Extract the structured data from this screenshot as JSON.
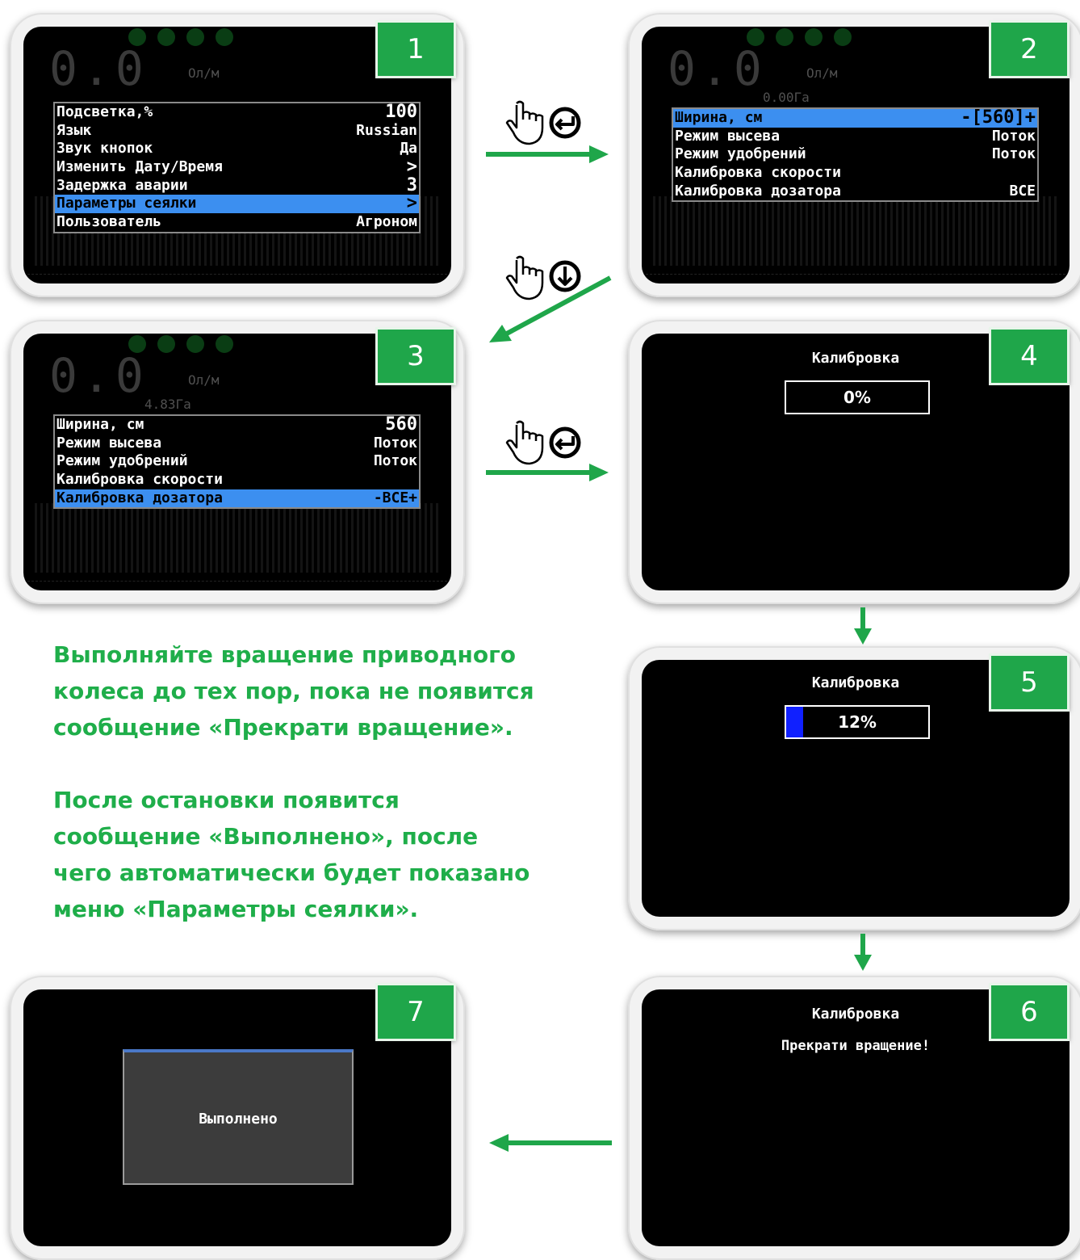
{
  "colors": {
    "accent_green": "#1fa64a",
    "selection_blue": "#3c8ff0",
    "progress_blue": "#1020ff"
  },
  "dashboard": {
    "value": "0.0",
    "rate_units": "Ол/м"
  },
  "steps": {
    "s1": {
      "number": "1",
      "menu": [
        {
          "label": "Подсветка,%",
          "value": "100"
        },
        {
          "label": "Язык",
          "value": "Russian"
        },
        {
          "label": "Звук кнопок",
          "value": "Да"
        },
        {
          "label": "Изменить Дату/Время",
          "value": ">"
        },
        {
          "label": "Задержка аварии",
          "value": "3"
        },
        {
          "label": "Параметры сеялки",
          "value": ">"
        },
        {
          "label": "Пользователь",
          "value": "Агроном"
        }
      ]
    },
    "s2": {
      "number": "2",
      "area": "0.00Га",
      "menu": [
        {
          "label": "Ширина, см",
          "value": "-[560]+"
        },
        {
          "label": "Режим высева",
          "value": "Поток"
        },
        {
          "label": "Режим удобрений",
          "value": "Поток"
        },
        {
          "label": "Калибровка скорости",
          "value": ""
        },
        {
          "label": "Калибровка дозатора",
          "value": "ВСЕ"
        }
      ]
    },
    "s3": {
      "number": "3",
      "area": "4.83Га",
      "menu": [
        {
          "label": "Ширина, см",
          "value": "560"
        },
        {
          "label": "Режим высева",
          "value": "Поток"
        },
        {
          "label": "Режим удобрений",
          "value": "Поток"
        },
        {
          "label": "Калибровка скорости",
          "value": ""
        },
        {
          "label": "Калибровка дозатора",
          "value": "-ВСЕ+"
        }
      ]
    },
    "s4": {
      "number": "4",
      "title": "Калибровка",
      "progress_label": "0%",
      "progress": 0
    },
    "s5": {
      "number": "5",
      "title": "Калибровка",
      "progress_label": "12%",
      "progress": 0.12
    },
    "s6": {
      "number": "6",
      "title": "Калибровка",
      "message": "Прекрати вращение!"
    },
    "s7": {
      "number": "7",
      "message": "Выполнено"
    }
  },
  "icons": {
    "enter_press": "hand-enter-icon",
    "down_press": "hand-down-icon",
    "arrow": "green-arrow-icon"
  },
  "instructions": {
    "p1": [
      "Выполняйте вращение приводного",
      "колеса до тех пор, пока не появится",
      "сообщение «Прекрати вращение»."
    ],
    "p2": [
      "После остановки появится",
      "сообщение «Выполнено», после",
      "чего автоматически будет показано",
      "меню «Параметры сеялки»."
    ]
  }
}
